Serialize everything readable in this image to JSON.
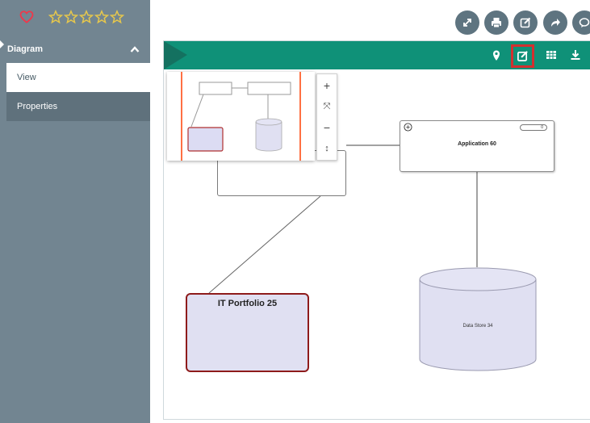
{
  "sidebar": {
    "rating_max": 5,
    "rating_value": 0,
    "header": {
      "label": "Diagram"
    },
    "items": [
      {
        "label": "View",
        "active": true
      },
      {
        "label": "Properties",
        "active": false
      }
    ]
  },
  "toolbar": {
    "buttons": [
      {
        "icon": "expand-icon"
      },
      {
        "icon": "print-icon"
      },
      {
        "icon": "edit-icon"
      },
      {
        "icon": "share-icon"
      },
      {
        "icon": "comment-icon"
      }
    ]
  },
  "panel": {
    "icons": [
      "location-pin-icon",
      "edit-icon",
      "grid-icon",
      "download-icon"
    ]
  },
  "diagram": {
    "nodes": {
      "application": {
        "label": "Application 60",
        "badge": "0"
      },
      "portfolio": {
        "label": "IT Portfolio 25"
      },
      "datastore": {
        "label": "Data Store 34"
      }
    }
  },
  "zoom": {
    "zoom_in": "+",
    "fit": "⤧",
    "zoom_out": "−",
    "reset": "↕"
  },
  "colors": {
    "sidebar_bg": "#728591",
    "panel_bar": "#0f9178",
    "highlight": "#d32f2f",
    "portfolio_border": "#8e1b1b",
    "node_fill": "#e0e0f2",
    "star": "#e6c74c"
  }
}
